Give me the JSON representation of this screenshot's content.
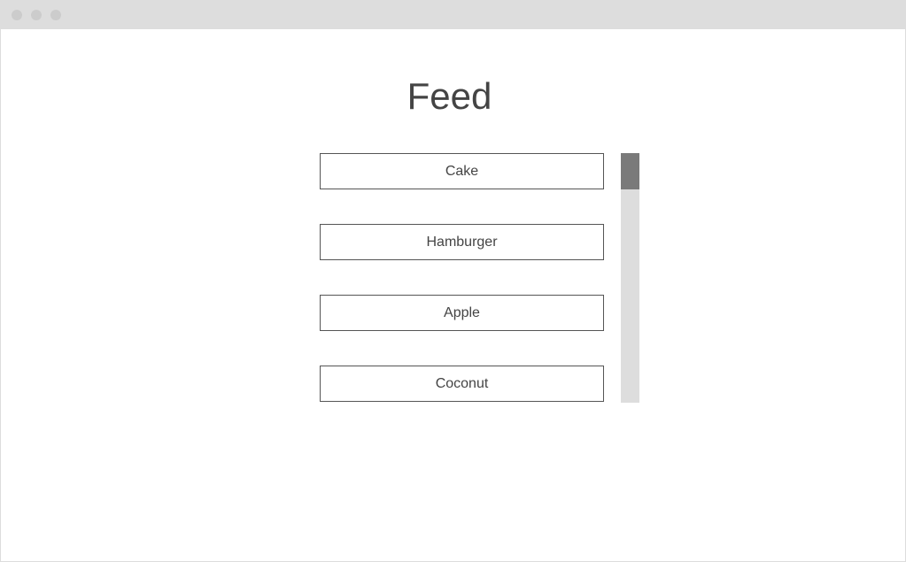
{
  "page": {
    "title": "Feed"
  },
  "feed": {
    "items": [
      {
        "label": "Cake"
      },
      {
        "label": "Hamburger"
      },
      {
        "label": "Apple"
      },
      {
        "label": "Coconut"
      }
    ]
  },
  "colors": {
    "titlebar": "#dddddd",
    "window_dot": "#cccccc",
    "text": "#444444",
    "item_border": "#555555",
    "scroll_track": "#dddddd",
    "scroll_thumb": "#7a7a7a"
  }
}
